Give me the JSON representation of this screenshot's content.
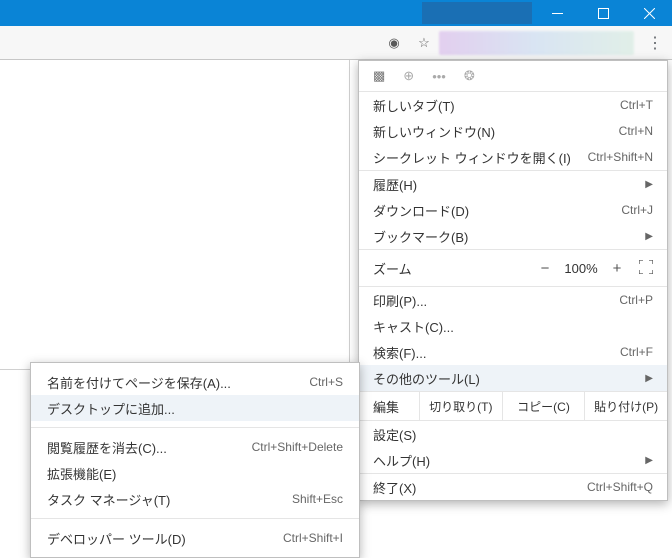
{
  "window": {
    "minimize": "—",
    "maximize": "□",
    "close": "✕"
  },
  "menu": {
    "new_tab": {
      "label": "新しいタブ(T)",
      "shortcut": "Ctrl+T"
    },
    "new_window": {
      "label": "新しいウィンドウ(N)",
      "shortcut": "Ctrl+N"
    },
    "incognito": {
      "label": "シークレット ウィンドウを開く(I)",
      "shortcut": "Ctrl+Shift+N"
    },
    "history": {
      "label": "履歴(H)",
      "shortcut": ""
    },
    "downloads": {
      "label": "ダウンロード(D)",
      "shortcut": "Ctrl+J"
    },
    "bookmarks": {
      "label": "ブックマーク(B)",
      "shortcut": ""
    },
    "zoom": {
      "label": "ズーム",
      "value": "100%",
      "minus": "−",
      "plus": "+"
    },
    "print": {
      "label": "印刷(P)...",
      "shortcut": "Ctrl+P"
    },
    "cast": {
      "label": "キャスト(C)...",
      "shortcut": ""
    },
    "find": {
      "label": "検索(F)...",
      "shortcut": "Ctrl+F"
    },
    "more_tools": {
      "label": "その他のツール(L)",
      "shortcut": ""
    },
    "edit": {
      "label": "編集",
      "cut": "切り取り(T)",
      "copy": "コピー(C)",
      "paste": "貼り付け(P)"
    },
    "settings": {
      "label": "設定(S)",
      "shortcut": ""
    },
    "help": {
      "label": "ヘルプ(H)",
      "shortcut": ""
    },
    "exit": {
      "label": "終了(X)",
      "shortcut": "Ctrl+Shift+Q"
    }
  },
  "submenu": {
    "save_as": {
      "label": "名前を付けてページを保存(A)...",
      "shortcut": "Ctrl+S"
    },
    "add_desktop": {
      "label": "デスクトップに追加...",
      "shortcut": ""
    },
    "clear_history": {
      "label": "閲覧履歴を消去(C)...",
      "shortcut": "Ctrl+Shift+Delete"
    },
    "extensions": {
      "label": "拡張機能(E)",
      "shortcut": ""
    },
    "task_manager": {
      "label": "タスク マネージャ(T)",
      "shortcut": "Shift+Esc"
    },
    "dev_tools": {
      "label": "デベロッパー ツール(D)",
      "shortcut": "Ctrl+Shift+I"
    }
  }
}
